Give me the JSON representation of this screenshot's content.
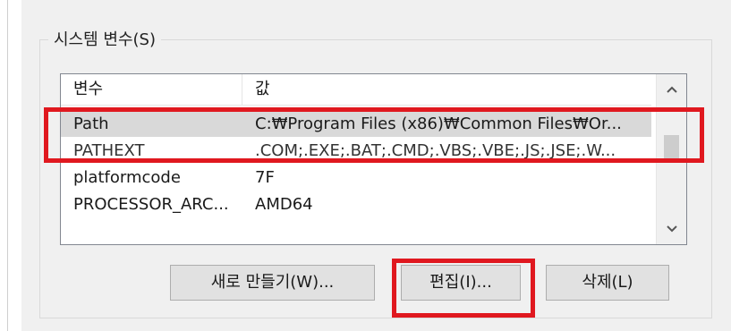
{
  "group": {
    "title": "시스템 변수(S)"
  },
  "table": {
    "headers": {
      "name": "변수",
      "value": "값"
    },
    "rows": [
      {
        "name": "Path",
        "value": "C:₩Program Files (x86)₩Common Files₩Or...",
        "selected": true
      },
      {
        "name": "PATHEXT",
        "value": ".COM;.EXE;.BAT;.CMD;.VBS;.VBE;.JS;.JSE;.W...",
        "selected": false
      },
      {
        "name": "platformcode",
        "value": "7F",
        "selected": false
      },
      {
        "name": "PROCESSOR_ARC...",
        "value": "AMD64",
        "selected": false
      }
    ]
  },
  "scrollbar": {
    "up_icon": "chevron-up-icon",
    "down_icon": "chevron-down-icon"
  },
  "buttons": {
    "new_label": "새로 만들기(W)...",
    "edit_label": "편집(I)...",
    "delete_label": "삭제(L)"
  },
  "colors": {
    "panel_bg": "#f0f0f0",
    "list_bg": "#ffffff",
    "selection_bg": "#d9d9d9",
    "button_bg": "#e1e1e1",
    "highlight_red": "#e0181f"
  }
}
